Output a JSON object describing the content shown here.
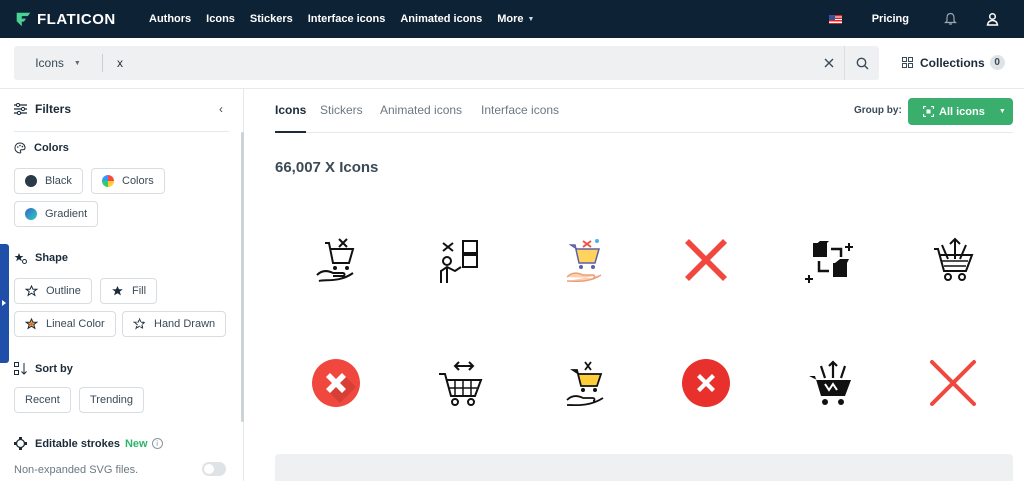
{
  "brand": {
    "logo_text": "FLATICON"
  },
  "nav": {
    "links": [
      "Authors",
      "Icons",
      "Stickers",
      "Interface icons",
      "Animated icons",
      "More"
    ],
    "pricing": "Pricing"
  },
  "search": {
    "type_label": "Icons",
    "query": "x",
    "collections_label": "Collections",
    "collections_count": "0"
  },
  "sidebar": {
    "title": "Filters",
    "colors": {
      "title": "Colors",
      "options": [
        "Black",
        "Colors",
        "Gradient"
      ]
    },
    "shape": {
      "title": "Shape",
      "options": [
        "Outline",
        "Fill",
        "Lineal Color",
        "Hand Drawn"
      ]
    },
    "sort": {
      "title": "Sort by",
      "options": [
        "Recent",
        "Trending"
      ]
    },
    "editable": {
      "title": "Editable strokes",
      "badge": "New",
      "info": "i",
      "note": "Non-expanded SVG files."
    }
  },
  "main": {
    "tabs": [
      "Icons",
      "Stickers",
      "Animated icons",
      "Interface icons"
    ],
    "group_by_label": "Group by:",
    "group_by_value": "All icons",
    "result_title": "66,007 X Icons"
  },
  "icons": [
    "cart-hand-outline-icon",
    "delivery-person-boxes-icon",
    "cart-hand-color-icon",
    "red-x-icon",
    "box-swap-icon",
    "cart-arrows-outline-icon",
    "red-x-circle-shadow-icon",
    "cart-arrows-horizontal-icon",
    "cart-hand-yellow-icon",
    "red-x-circle-icon",
    "cart-arrows-fill-icon",
    "red-x-thin-icon"
  ],
  "colors": {
    "nav_bg": "#0e2235",
    "accent_green": "#3aaf6d",
    "x_red": "#f0483e",
    "edge_tab": "#1f4fa8"
  }
}
